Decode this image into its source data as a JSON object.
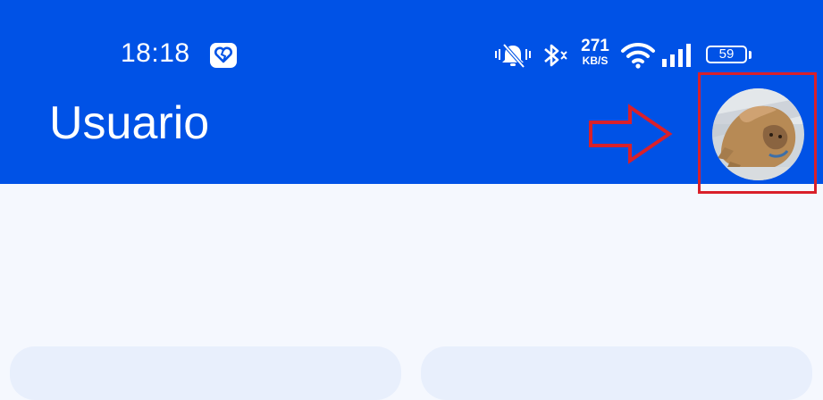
{
  "status_bar": {
    "time": "18:18",
    "net_speed_value": "271",
    "net_speed_unit": "KB/S",
    "battery_percent": "59",
    "icons": [
      "notification-heart-icon",
      "mute-bell-icon",
      "bluetooth-icon",
      "wifi-icon",
      "signal-icon",
      "battery-icon"
    ]
  },
  "app_bar": {
    "title": "Usuario",
    "background_color": "#0052e6"
  },
  "annotation": {
    "arrow_icon": "red-arrow-icon",
    "box_color": "#d9202a"
  },
  "avatar": {
    "icon": "user-avatar-photo"
  },
  "cards": [
    {
      "id": "left"
    },
    {
      "id": "right"
    }
  ],
  "colors": {
    "page_background": "#f5f8fe",
    "card_background": "#e8effc"
  }
}
